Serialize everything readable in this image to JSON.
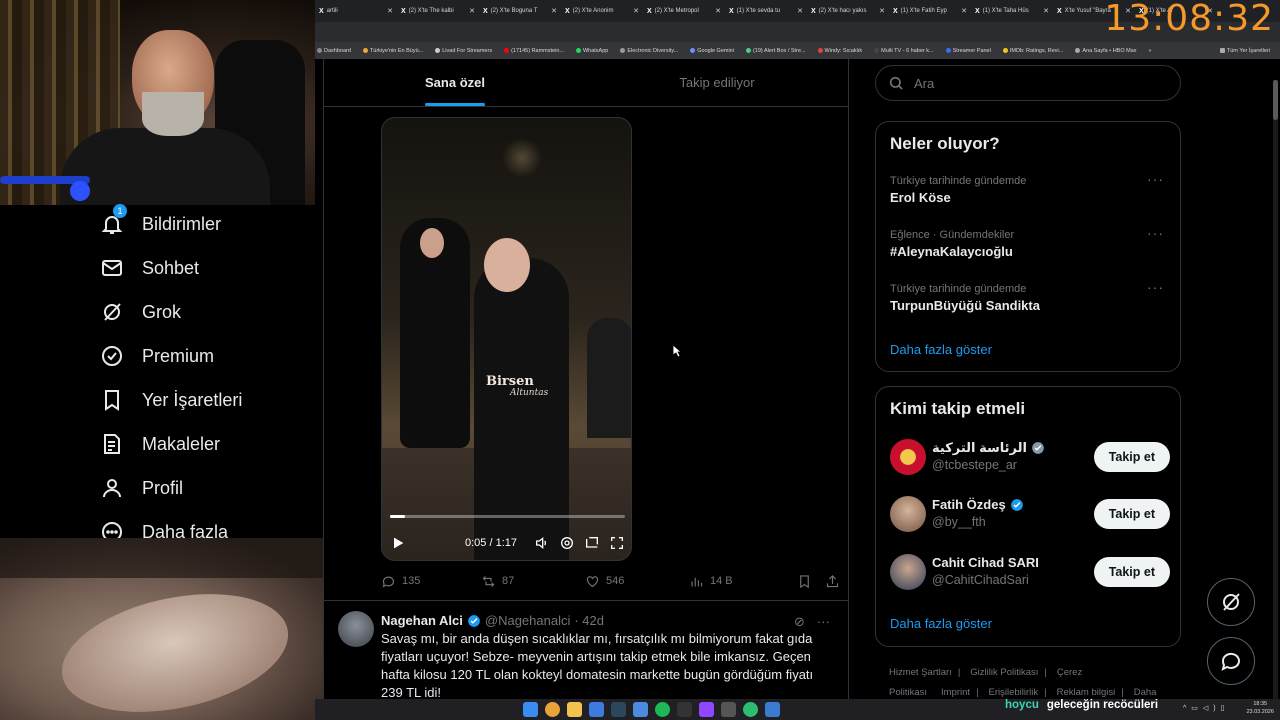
{
  "overlay": {
    "clock": "13:08:32",
    "chat_user": "hoycu",
    "chat_message": "geleceğin recöcüleri"
  },
  "browser": {
    "tabs": [
      {
        "label": "artili"
      },
      {
        "label": "(2) X'te The kalbi"
      },
      {
        "label": "(2) X'te Boguna T"
      },
      {
        "label": "(2) X'te Anonim"
      },
      {
        "label": "(2) X'te Metropol"
      },
      {
        "label": "(1) X'te sevda tu"
      },
      {
        "label": "(2) X'te hacı yakıs"
      },
      {
        "label": "(1) X'te Fatih Eyp"
      },
      {
        "label": "(1) X'te Taha Hüs"
      },
      {
        "label": "X'te Yusuf \"Bayra"
      },
      {
        "label": "(1) X'te Ar"
      }
    ],
    "bookmarks": [
      {
        "label": "Dashboard",
        "color": "#888"
      },
      {
        "label": "Türkiye'nin En Büyü...",
        "color": "#f2a33a"
      },
      {
        "label": "Livad For Streamers",
        "color": "#ccc"
      },
      {
        "label": "(17145) Rammstein...",
        "color": "#ff0000"
      },
      {
        "label": "WhatsApp",
        "color": "#25d366"
      },
      {
        "label": "Electronic Diversity...",
        "color": "#999"
      },
      {
        "label": "Google Gemini",
        "color": "#6d8cff"
      },
      {
        "label": "(19) Alert Box / Stre...",
        "color": "#4ec98f"
      },
      {
        "label": "Windy: Sıcaklık",
        "color": "#e0453a"
      },
      {
        "label": "Multi TV - 6 haber k...",
        "color": "#444"
      },
      {
        "label": "Streamer Panel",
        "color": "#3a6df0"
      },
      {
        "label": "IMDb: Ratings, Revi...",
        "color": "#f5c518"
      },
      {
        "label": "Ana Sayfa • HBO Max",
        "color": "#aaa"
      }
    ],
    "bookmarks_overflow": "»",
    "bookmarks_all": "Tüm Yer İşaretleri"
  },
  "nav": {
    "notifications": {
      "label": "Bildirimler",
      "badge": "1"
    },
    "messages": {
      "label": "Sohbet"
    },
    "grok": {
      "label": "Grok"
    },
    "premium": {
      "label": "Premium"
    },
    "bookmarks": {
      "label": "Yer İşaretleri"
    },
    "articles": {
      "label": "Makaleler"
    },
    "profile": {
      "label": "Profil"
    },
    "more": {
      "label": "Daha fazla"
    }
  },
  "feed": {
    "tabs": [
      {
        "label": "Sana özel",
        "active": true
      },
      {
        "label": "Takip ediliyor",
        "active": false
      }
    ],
    "post1": {
      "video": {
        "watermark": "Birsen",
        "watermark_sub": "Altuntas",
        "time": "0:05 / 1:17",
        "progress": 0.065
      },
      "replies": "135",
      "reposts": "87",
      "likes": "546",
      "views": "14 B"
    },
    "post2": {
      "name": "Nagehan Alci",
      "handle": "@Nagehanalci",
      "time": "· 42d",
      "text": "Savaş mı, bir anda düşen sıcaklıklar mı, fırsatçılık mı bilmiyorum fakat gıda fiyatları uçuyor! Sebze- meyvenin artışını takip etmek bile imkansız. Geçen hafta kilosu 120 TL olan   kokteyl domatesin markette bugün gördüğüm fiyatı 239 TL idi!"
    }
  },
  "sidebar": {
    "search_placeholder": "Ara",
    "trends_title": "Neler oluyor?",
    "trends": [
      {
        "meta": "Türkiye tarihinde gündemde",
        "name": "Erol Köse"
      },
      {
        "meta": "Eğlence · Gündemdekiler",
        "name": "#AleynaKalaycıoğlu"
      },
      {
        "meta": "Türkiye tarihinde gündemde",
        "name": "TurpunBüyüğü Sandikta"
      }
    ],
    "trends_more": "Daha fazla göster",
    "follow_title": "Kimi takip etmeli",
    "follow": [
      {
        "name": "الرئاسة التركية",
        "handle": "@tcbestepe_ar",
        "button": "Takip et",
        "avatar_color": "#c8102e"
      },
      {
        "name": "Fatih Özdeş",
        "handle": "@by__fth",
        "button": "Takip et",
        "avatar_color": "#8a6a50"
      },
      {
        "name": "Cahit Cihad SARI",
        "handle": "@CahitCihadSari",
        "button": "Takip et",
        "avatar_color": "#3a4a6a"
      }
    ],
    "follow_more": "Daha fazla göster",
    "footer": [
      "Hizmet Şartları",
      "Gizlilik Politikası",
      "Çerez Politikası",
      "Imprint",
      "Erişilebilirlik",
      "Reklam bilgisi",
      "Daha fazla ..."
    ]
  },
  "taskbar": {
    "time": "18:35",
    "date": "23.03.2026"
  },
  "colors": {
    "accent": "#1d9bf0",
    "clock": "#f59a2a"
  }
}
